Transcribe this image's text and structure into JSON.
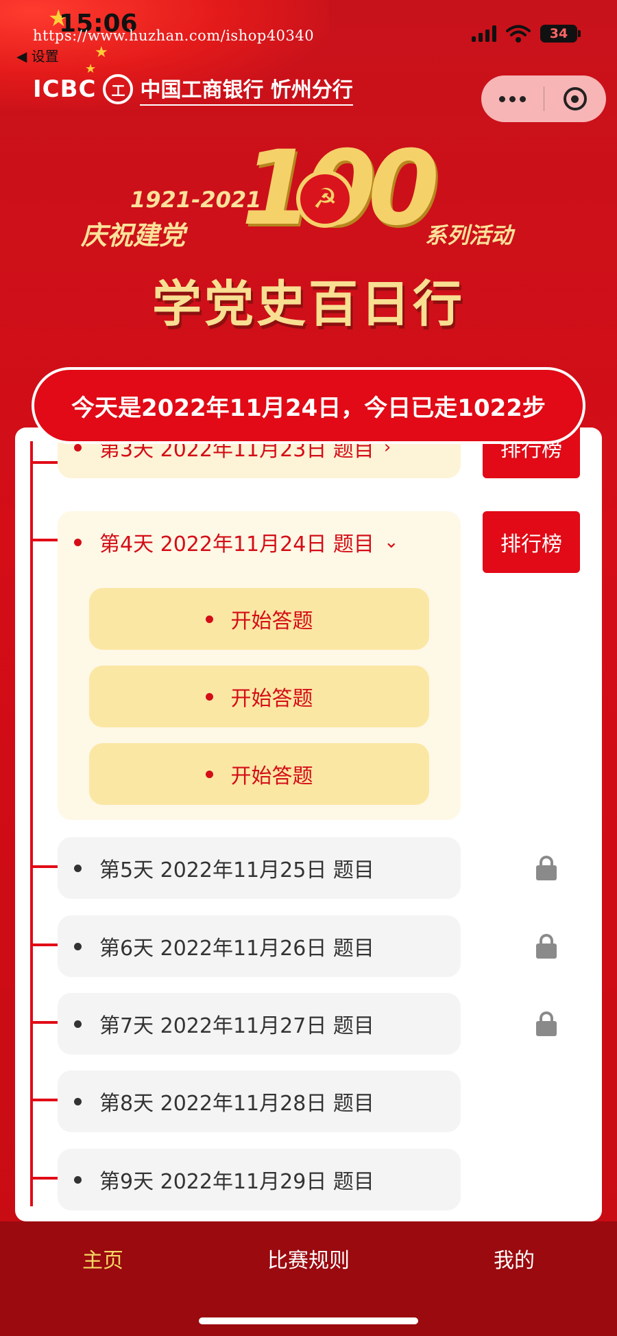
{
  "status_bar": {
    "time": "15:06",
    "back_label": "◀ 设置",
    "battery": "34"
  },
  "url_overlay": "https://www.huzhan.com/ishop40340",
  "brand": {
    "icbc": "ICBC",
    "logo_glyph": "工",
    "name": "中国工商银行 忻州分行"
  },
  "banner": {
    "years": "1921-2021",
    "celebrate": "庆祝建党",
    "hundred": "100",
    "series": "系列活动",
    "main_title": "学党史百日行"
  },
  "today_text": "今天是2022年11月24日，今日已走1022步",
  "days": [
    {
      "label": "第3天 2022年11月23日 题目",
      "chevron": "›",
      "rank": "排行榜"
    },
    {
      "label": "第4天 2022年11月24日 题目",
      "chevron": "⌄",
      "rank": "排行榜"
    },
    {
      "label": "第5天 2022年11月25日 题目"
    },
    {
      "label": "第6天 2022年11月26日 题目"
    },
    {
      "label": "第7天 2022年11月27日 题目"
    },
    {
      "label": "第8天 2022年11月28日 题目"
    },
    {
      "label": "第9天 2022年11月29日 题目"
    }
  ],
  "start_buttons": [
    "开始答题",
    "开始答题",
    "开始答题"
  ],
  "tabs": [
    {
      "label": "主页",
      "active": true
    },
    {
      "label": "比赛规则",
      "active": false
    },
    {
      "label": "我的",
      "active": false
    }
  ],
  "colors": {
    "primary_red": "#e10a16",
    "tab_bar": "#9a0a0f",
    "active_tab": "#f6d865",
    "cream": "#fdf3d6",
    "gold_button": "#fbe7a4"
  }
}
